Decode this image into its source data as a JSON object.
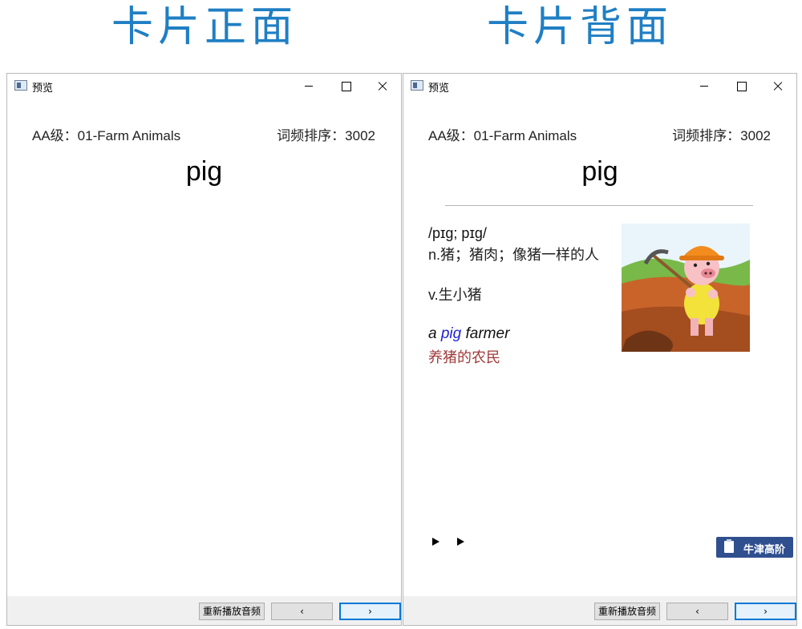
{
  "headings": {
    "front": "卡片正面",
    "back": "卡片背面"
  },
  "colors": {
    "heading": "#1f7fc4",
    "keyword": "#1f1fd8",
    "translation": "#a23a3a",
    "dict_button": "#2f4f8f",
    "focus_border": "#0078d7"
  },
  "front_window": {
    "title": "预览",
    "level": "AA级：01-Farm Animals",
    "frequency": "词频排序：3002",
    "word": "pig",
    "buttons": {
      "replay": "重新播放音频",
      "prev": "‹",
      "next": "›"
    }
  },
  "back_window": {
    "title": "预览",
    "level": "AA级：01-Farm Animals",
    "frequency": "词频排序：3002",
    "word": "pig",
    "phonetic": "/pɪɡ; pɪɡ/",
    "noun_pos": "n.",
    "noun_def": "猪；猪肉；像猪一样的人",
    "verb_pos": "v.",
    "verb_def": "生小猪",
    "example": {
      "before": "a ",
      "keyword": "pig",
      "after": " farmer"
    },
    "translation": "养猪的农民",
    "picture_icon": "pig-farmer-illustration",
    "play_icons": [
      "play-icon",
      "play-icon"
    ],
    "dict_button": "牛津高阶",
    "buttons": {
      "replay": "重新播放音频",
      "prev": "‹",
      "next": "›"
    }
  }
}
